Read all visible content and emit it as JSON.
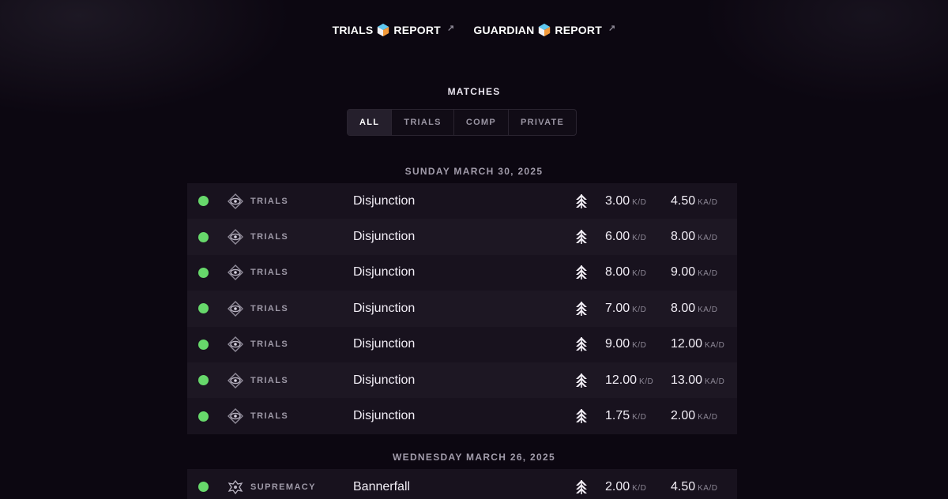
{
  "nav": {
    "links": [
      {
        "left": "TRIALS",
        "right": "REPORT"
      },
      {
        "left": "GUARDIAN",
        "right": "REPORT"
      }
    ],
    "external_icon": "↗"
  },
  "matches": {
    "title": "MATCHES",
    "filters": [
      "ALL",
      "TRIALS",
      "COMP",
      "PRIVATE"
    ],
    "active_filter": "ALL"
  },
  "groups": [
    {
      "date": "SUNDAY MARCH 30, 2025",
      "rows": [
        {
          "result": "win",
          "mode": "TRIALS",
          "map": "Disjunction",
          "kd": "3.00",
          "kad": "4.50"
        },
        {
          "result": "win",
          "mode": "TRIALS",
          "map": "Disjunction",
          "kd": "6.00",
          "kad": "8.00"
        },
        {
          "result": "win",
          "mode": "TRIALS",
          "map": "Disjunction",
          "kd": "8.00",
          "kad": "9.00"
        },
        {
          "result": "win",
          "mode": "TRIALS",
          "map": "Disjunction",
          "kd": "7.00",
          "kad": "8.00"
        },
        {
          "result": "win",
          "mode": "TRIALS",
          "map": "Disjunction",
          "kd": "9.00",
          "kad": "12.00"
        },
        {
          "result": "win",
          "mode": "TRIALS",
          "map": "Disjunction",
          "kd": "12.00",
          "kad": "13.00"
        },
        {
          "result": "win",
          "mode": "TRIALS",
          "map": "Disjunction",
          "kd": "1.75",
          "kad": "2.00"
        }
      ]
    },
    {
      "date": "WEDNESDAY MARCH 26, 2025",
      "rows": [
        {
          "result": "win",
          "mode": "SUPREMACY",
          "map": "Bannerfall",
          "kd": "2.00",
          "kad": "4.50"
        }
      ]
    }
  ],
  "units": {
    "kd": "K/D",
    "kad": "KA/D"
  },
  "colors": {
    "win": "#67d86b",
    "background": "#0c0711",
    "row_a": "#18121e",
    "row_b": "#1d1723"
  },
  "icons": {
    "trials_mode": "trials-eye-icon",
    "supremacy_mode": "supremacy-crest-icon",
    "class": "hunter-class-icon",
    "brand_cube": "cube-logo-icon",
    "external": "external-link-icon"
  }
}
